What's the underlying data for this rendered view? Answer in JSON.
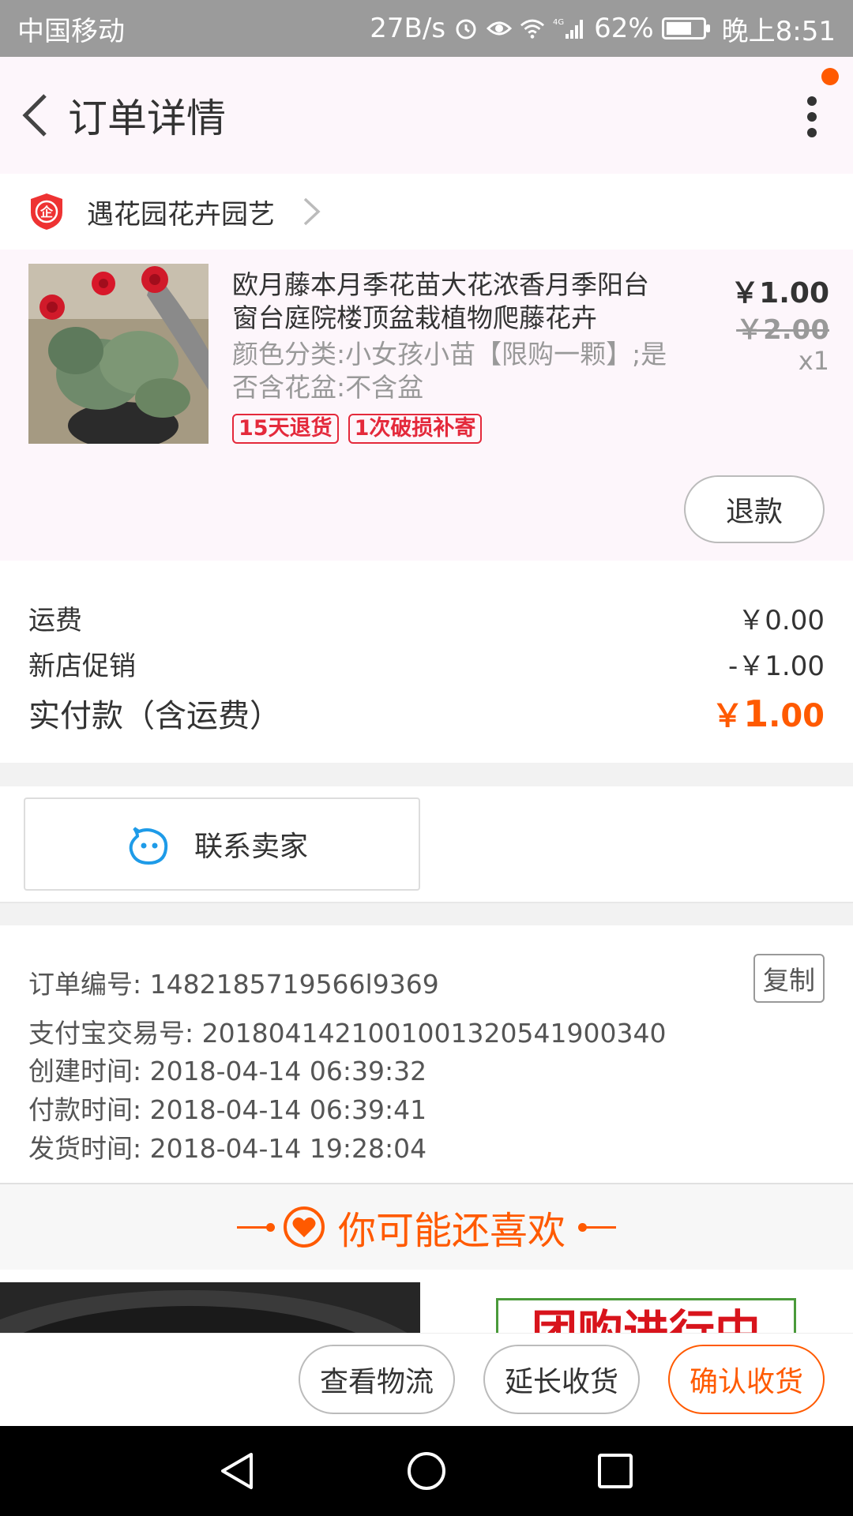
{
  "status_bar": {
    "carrier": "中国移动",
    "speed": "27B/s",
    "network": "4G",
    "battery": "62%",
    "time": "晚上8:51"
  },
  "header": {
    "title": "订单详情"
  },
  "shop": {
    "badge": "企",
    "name": "遇花园花卉园艺"
  },
  "item": {
    "title": "欧月藤本月季花苗大花浓香月季阳台窗台庭院楼顶盆栽植物爬藤花卉",
    "sku": "颜色分类:小女孩小苗【限购一颗】;是否含花盆:不含盆",
    "tags": [
      "15天退货",
      "1次破损补寄"
    ],
    "price": "￥1.00",
    "original_price": "￥2.00",
    "quantity": "x1",
    "refund_label": "退款"
  },
  "fees": {
    "shipping_label": "运费",
    "shipping_value": "￥0.00",
    "promo_label": "新店促销",
    "promo_value": "-￥1.00",
    "total_label": "实付款（含运费）",
    "total_currency": "￥",
    "total_int": "1",
    "total_dec": ".00"
  },
  "contact": {
    "label": "联系卖家"
  },
  "order_info": {
    "order_no": "订单编号: 1482185719566l9369",
    "copy_label": "复制",
    "alipay_no": "支付宝交易号: 2018041421001001320541900340",
    "created": "创建时间: 2018-04-14 06:39:32",
    "paid": "付款时间: 2018-04-14 06:39:41",
    "shipped": "发货时间: 2018-04-14 19:28:04"
  },
  "recommend": {
    "title": "你可能还喜欢",
    "banner_text": "团购进行中"
  },
  "actions": {
    "logistics": "查看物流",
    "extend": "延长收货",
    "confirm": "确认收货"
  },
  "colors": {
    "accent": "#ff5a00",
    "tag_red": "#e4293b",
    "status_bar": "#9b9b9b",
    "header_bg": "#fdf6fb"
  }
}
